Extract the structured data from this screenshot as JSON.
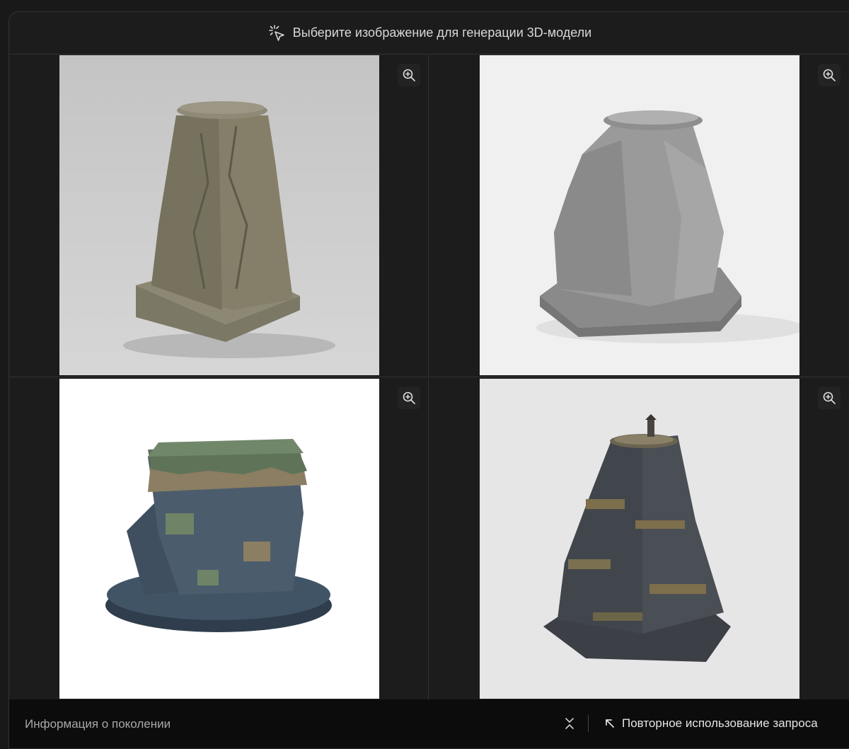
{
  "header": {
    "title": "Выберите изображение для генерации 3D-модели",
    "icon": "cursor-click-icon"
  },
  "images": [
    {
      "background": "#cbcbcb",
      "tone": "#8a8470",
      "zoom_icon": "zoom-in-icon"
    },
    {
      "background": "#f0f0f0",
      "tone": "#8e8e8e",
      "zoom_icon": "zoom-in-icon"
    },
    {
      "background": "#ffffff",
      "tone": "#3b4a5a",
      "zoom_icon": "zoom-in-icon"
    },
    {
      "background": "#e6e6e6",
      "tone": "#4a4e55",
      "zoom_icon": "zoom-in-icon"
    }
  ],
  "footer": {
    "info_label": "Информация о поколении",
    "collapse_icon": "chevrons-collapse-icon",
    "reuse_label": "Повторное использование запроса",
    "reuse_icon": "arrow-up-left-icon"
  }
}
